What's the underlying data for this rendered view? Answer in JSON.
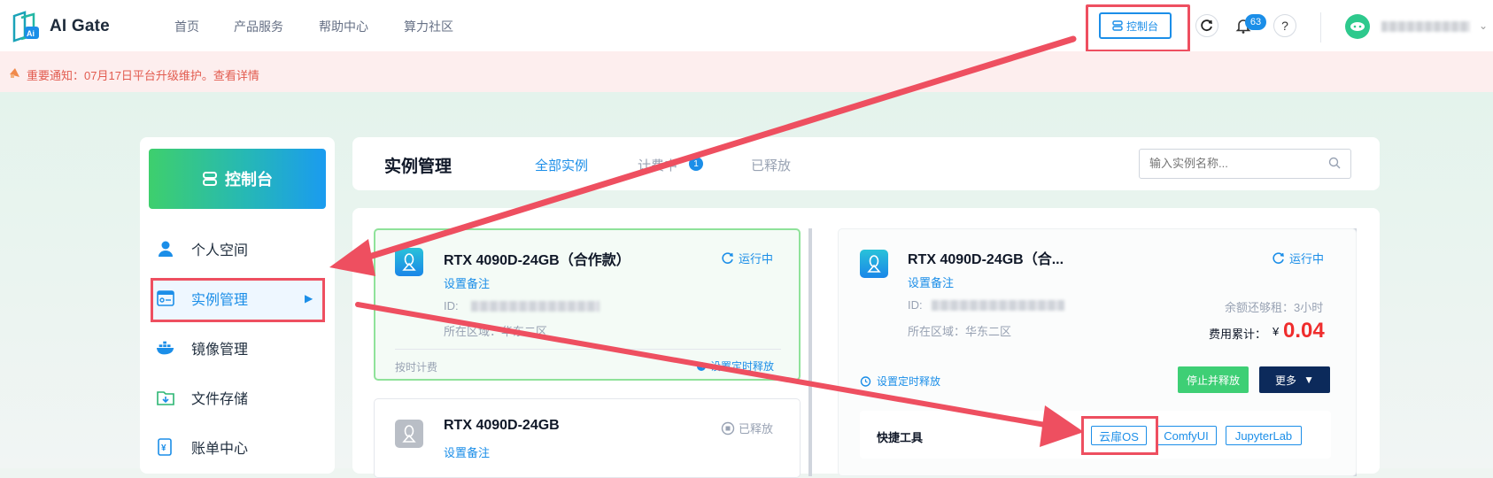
{
  "topnav": {
    "logo": "AI Gate",
    "items": [
      "首页",
      "产品服务",
      "帮助中心",
      "算力社区"
    ],
    "console_label": "控制台",
    "notification_count": "63",
    "help": "?",
    "refresh_icon": "refresh-circle-icon"
  },
  "notice": {
    "text": "重要通知：07月17日平台升级维护。查看详情"
  },
  "sidebar": {
    "hero": "控制台",
    "items": [
      {
        "label": "个人空间",
        "icon": "user-icon"
      },
      {
        "label": "实例管理",
        "icon": "instance-icon",
        "active": true
      },
      {
        "label": "镜像管理",
        "icon": "docker-icon"
      },
      {
        "label": "文件存储",
        "icon": "folder-icon"
      },
      {
        "label": "账单中心",
        "icon": "bill-icon"
      }
    ]
  },
  "header": {
    "title": "实例管理",
    "tabs": [
      {
        "label": "全部实例",
        "active": true
      },
      {
        "label": "计费中",
        "badge": "1"
      },
      {
        "label": "已释放"
      }
    ],
    "search_placeholder": "输入实例名称..."
  },
  "cards": [
    {
      "title": "RTX 4090D-24GB（合作款）",
      "status": "运行中",
      "note": "设置备注",
      "id_label": "ID:",
      "region": "所在区域：华东二区",
      "billing": "按时计费",
      "timer": "设置定时释放"
    },
    {
      "title": "RTX 4090D-24GB",
      "status": "已释放",
      "note": "设置备注"
    }
  ],
  "detail": {
    "title": "RTX 4090D-24GB（合...",
    "status": "运行中",
    "note": "设置备注",
    "id_label": "ID:",
    "region": "所在区域：华东二区",
    "balance": "余额还够租：3小时",
    "cost_label": "费用累计：",
    "currency": "¥",
    "cost": "0.04",
    "timer": "设置定时释放",
    "stop_btn": "停止并释放",
    "more_btn": "更多",
    "quick_label": "快捷工具",
    "tools": [
      "云扉OS",
      "ComfyUI",
      "JupyterLab"
    ]
  },
  "colors": {
    "accent": "#1b8ee8",
    "highlight": "#ee4f60",
    "cost": "#ef2d2d",
    "green": "#3ecf75"
  }
}
